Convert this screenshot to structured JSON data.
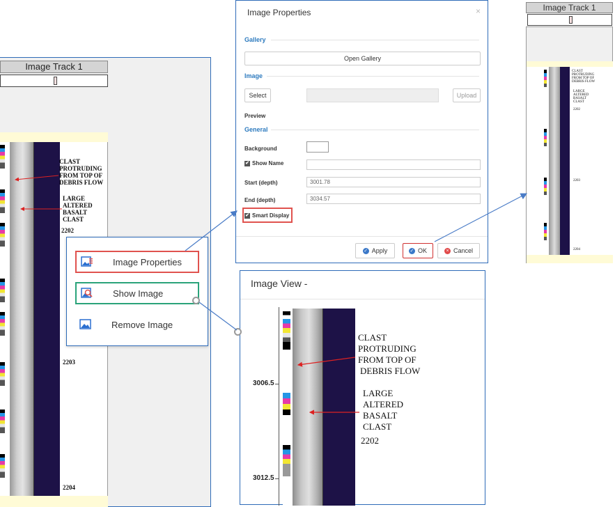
{
  "left_track": {
    "title": "Image Track 1",
    "labels": {
      "clast_line1": "CLAST",
      "clast_line2": "PROTRUDING",
      "clast_line3": "FROM TOP OF",
      "clast_line4": "DEBRIS FLOW",
      "large_line1": "LARGE",
      "large_line2": "ALTERED",
      "large_line3": "BASALT",
      "large_line4": "CLAST",
      "num_2202": "2202",
      "num_2203": "2203",
      "num_2204": "2204"
    }
  },
  "context_menu": {
    "items": [
      {
        "label": "Image Properties",
        "icon": "image-properties-icon"
      },
      {
        "label": "Show Image",
        "icon": "search-image-icon"
      },
      {
        "label": "Remove Image",
        "icon": "image-icon"
      }
    ],
    "highlight_colors": {
      "properties": "#e0524e",
      "show": "#2aa37a"
    }
  },
  "dialog": {
    "title": "Image Properties",
    "close": "×",
    "sections": {
      "gallery": "Gallery",
      "image": "Image",
      "general": "General"
    },
    "open_gallery": "Open Gallery",
    "select": "Select",
    "upload": "Upload",
    "preview": "Preview",
    "background": "Background",
    "show_name": "Show Name",
    "start_label": "Start (depth)",
    "start_value": "3001.78",
    "end_label": "End (depth)",
    "end_value": "3034.57",
    "smart_display": "Smart Display",
    "apply": "Apply",
    "ok": "OK",
    "cancel": "Cancel"
  },
  "right_track": {
    "title": "Image Track 1",
    "labels": {
      "clast": "CLAST PROTRUDING FROM TOP OF DEBRIS FLOW",
      "large": "LARGE ALTERED BASALT CLAST",
      "n2202": "2202",
      "n2203": "2203",
      "n2204": "2204"
    }
  },
  "image_view": {
    "title": "Image View -",
    "depth_ticks": [
      "3006.5",
      "3012.5"
    ],
    "labels": {
      "clast_line1": "CLAST",
      "clast_line2": "PROTRUDING",
      "clast_line3": "FROM TOP OF",
      "clast_line4": "DEBRIS FLOW",
      "large_line1": "LARGE",
      "large_line2": "ALTERED",
      "large_line3": "BASALT",
      "large_line4": "CLAST",
      "num": "2202"
    }
  },
  "colors": {
    "accent_blue": "#2e7bbf",
    "highlight_red": "#e0524e",
    "highlight_green": "#2aa37a",
    "cancel_red": "#e14b4b",
    "apply_blue": "#3a78c8"
  }
}
